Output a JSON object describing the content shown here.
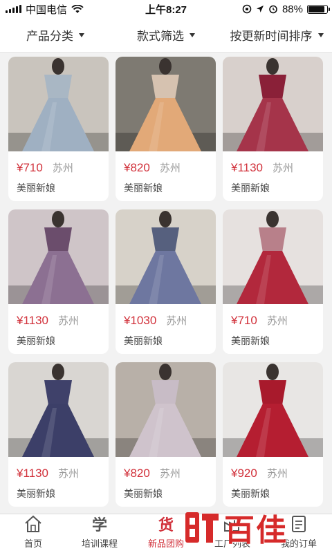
{
  "status": {
    "carrier": "中国电信",
    "time": "上午8:27",
    "battery": "88%",
    "battery_level": 0.88
  },
  "filters": [
    {
      "label": "产品分类",
      "icon": "caret-down-icon"
    },
    {
      "label": "款式筛选",
      "icon": "caret-down-icon"
    },
    {
      "label": "按更新时间排序",
      "icon": "caret-down-icon"
    }
  ],
  "products": [
    {
      "price": "¥710",
      "city": "苏州",
      "shop": "美丽新娘",
      "dress": "light-blue-off-shoulder-gown",
      "colors": {
        "bg": "#c9c4bd",
        "top": "#a9b7c4",
        "skirt": "#9fb0c2"
      }
    },
    {
      "price": "¥820",
      "city": "苏州",
      "shop": "美丽新娘",
      "dress": "champagne-tiered-gown",
      "colors": {
        "bg": "#7e7a72",
        "top": "#d6c2b0",
        "skirt": "#e2a978"
      }
    },
    {
      "price": "¥1130",
      "city": "苏州",
      "shop": "美丽新娘",
      "dress": "burgundy-v-neck-gown",
      "colors": {
        "bg": "#d8d0cc",
        "top": "#8a2038",
        "skirt": "#a5344a"
      }
    },
    {
      "price": "¥1130",
      "city": "苏州",
      "shop": "美丽新娘",
      "dress": "purple-tiered-gown",
      "colors": {
        "bg": "#cfc5c8",
        "top": "#6b4d6c",
        "skirt": "#8c7092"
      }
    },
    {
      "price": "¥1030",
      "city": "苏州",
      "shop": "美丽新娘",
      "dress": "blue-grey-sparkle-gown",
      "colors": {
        "bg": "#d7d2c9",
        "top": "#56607e",
        "skirt": "#6e77a0"
      }
    },
    {
      "price": "¥710",
      "city": "苏州",
      "shop": "美丽新娘",
      "dress": "red-off-shoulder-gown",
      "colors": {
        "bg": "#e6e1df",
        "top": "#b8808a",
        "skirt": "#b2283c"
      }
    },
    {
      "price": "¥1130",
      "city": "苏州",
      "shop": "美丽新娘",
      "dress": "navy-cape-gown",
      "colors": {
        "bg": "#d9d6d2",
        "top": "#3f416a",
        "skirt": "#3c3f68"
      }
    },
    {
      "price": "¥820",
      "city": "苏州",
      "shop": "美丽新娘",
      "dress": "lavender-ruffle-gown",
      "colors": {
        "bg": "#b8b0a8",
        "top": "#c8bcc6",
        "skirt": "#cfc3cc"
      }
    },
    {
      "price": "¥920",
      "city": "苏州",
      "shop": "美丽新娘",
      "dress": "red-mermaid-gown",
      "colors": {
        "bg": "#e8e6e4",
        "top": "#a81a2c",
        "skirt": "#b51e31"
      }
    }
  ],
  "tabs": [
    {
      "label": "首页",
      "icon_text": "",
      "icon": "home-icon",
      "active": false
    },
    {
      "label": "培训课程",
      "icon_text": "学",
      "icon": "study-icon",
      "active": false
    },
    {
      "label": "新品团购",
      "icon_text": "货",
      "icon": "goods-icon",
      "active": true
    },
    {
      "label": "工厂列表",
      "icon_text": "",
      "icon": "factory-icon",
      "active": false
    },
    {
      "label": "我的订单",
      "icon_text": "",
      "icon": "orders-icon",
      "active": false
    }
  ],
  "watermark": {
    "text": "百佳"
  }
}
